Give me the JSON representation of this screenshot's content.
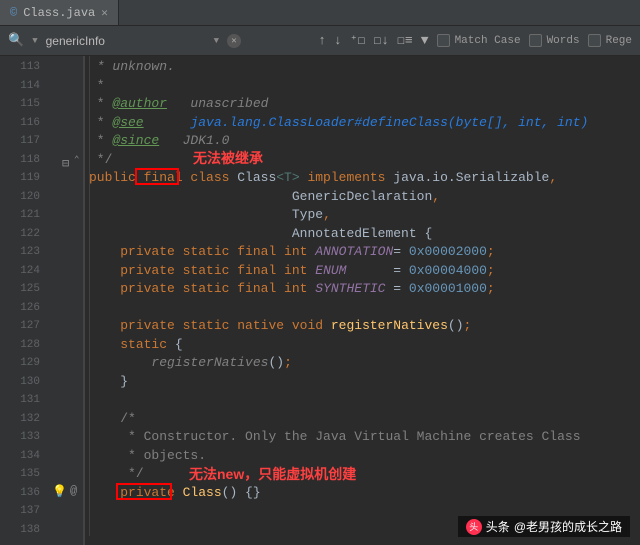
{
  "tab": {
    "label": "Class.java",
    "icon": "©"
  },
  "find": {
    "query": "genericInfo",
    "match_case": "Match Case",
    "words": "Words",
    "regex": "Rege"
  },
  "gutter": {
    "start": 113,
    "count": 26
  },
  "annotations": {
    "final_note": "无法被继承",
    "private_note": "无法new，只能虚拟机创建"
  },
  "watermark": {
    "prefix": "头条",
    "text": "@老男孩的成长之路"
  },
  "code": {
    "l113": " * unknown.",
    "l114": " *",
    "l115a": " * ",
    "l115b": "@author",
    "l115c": "   unascribed",
    "l116a": " * ",
    "l116b": "@see",
    "l116c": "      ",
    "l116d": "java.lang.ClassLoader#defineClass(byte[], int, int)",
    "l117a": " * ",
    "l117b": "@since",
    "l117c": "   JDK1.0",
    "l118": " */",
    "l119_pub": "public",
    "l119_final": " final ",
    "l119_class": "class ",
    "l119_name": "Class",
    "l119_gen": "<T>",
    "l119_impl": " implements ",
    "l119_ser": "java.io.Serializable",
    "l120": "GenericDeclaration",
    "l121": "Type",
    "l122": "AnnotatedElement {",
    "l123a": "private static final int ",
    "l123b": "ANNOTATION",
    "l123c": "= ",
    "l123d": "0x00002000",
    "l124a": "private static final int ",
    "l124b": "ENUM",
    "l124c": "      = ",
    "l124d": "0x00004000",
    "l125a": "private static final int ",
    "l125b": "SYNTHETIC",
    "l125c": " = ",
    "l125d": "0x00001000",
    "l127a": "private static native void ",
    "l127b": "registerNatives",
    "l127c": "()",
    "l128a": "static ",
    "l128b": "{",
    "l129a": "registerNatives",
    "l129b": "()",
    "l130": "}",
    "l132": "/*",
    "l133": " * Constructor. Only the Java Virtual Machine creates Class",
    "l134": " * objects.",
    "l135": " */",
    "l136a": "private ",
    "l136b": "Class",
    "l136c": "() {}"
  }
}
